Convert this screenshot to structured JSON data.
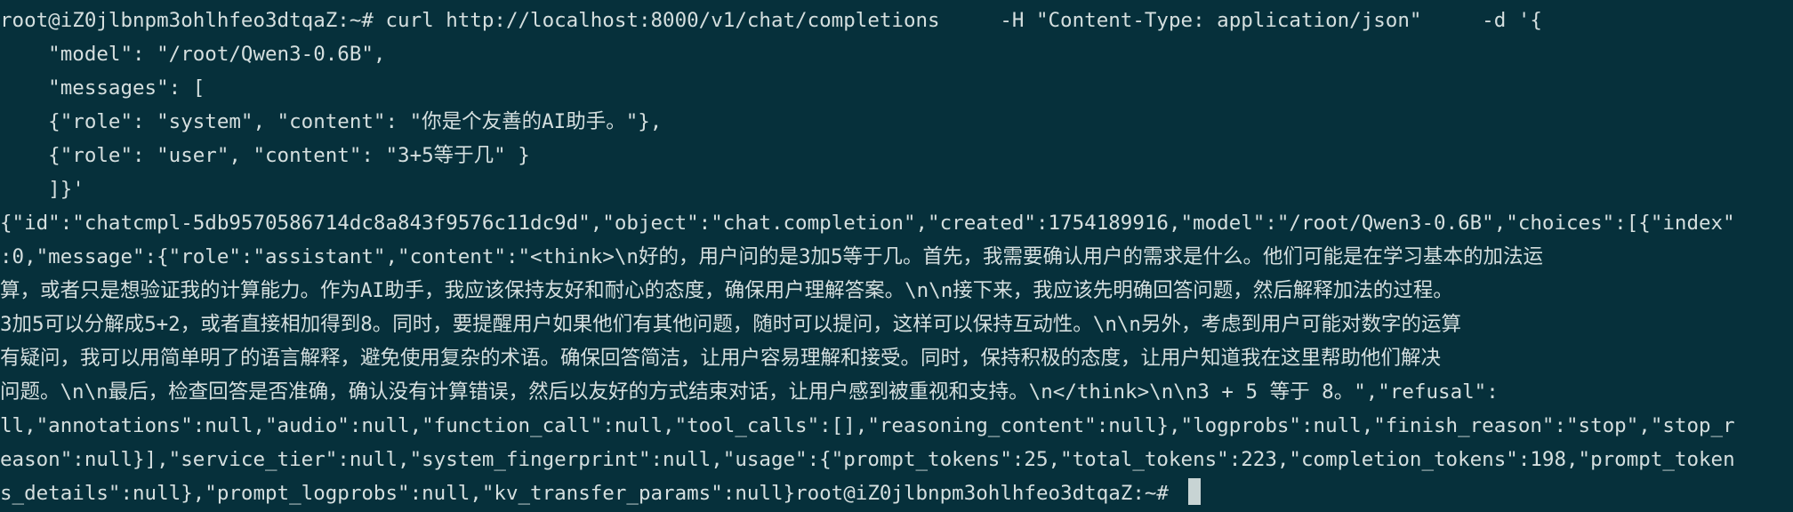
{
  "terminal": {
    "background": "#06303b",
    "foreground": "#d5dfdf",
    "lines": [
      "root@iZ0jlbnpm3ohlhfeo3dtqaZ:~# curl http://localhost:8000/v1/chat/completions     -H \"Content-Type: application/json\"     -d '{",
      "    \"model\": \"/root/Qwen3-0.6B\",",
      "    \"messages\": [",
      "    {\"role\": \"system\", \"content\": \"你是个友善的AI助手。\"},",
      "    {\"role\": \"user\", \"content\": \"3+5等于几\" }",
      "    ]}'",
      "{\"id\":\"chatcmpl-5db9570586714dc8a843f9576c11dc9d\",\"object\":\"chat.completion\",\"created\":1754189916,\"model\":\"/root/Qwen3-0.6B\",\"choices\":[{\"index\"",
      ":0,\"message\":{\"role\":\"assistant\",\"content\":\"<think>\\n好的，用户问的是3加5等于几。首先，我需要确认用户的需求是什么。他们可能是在学习基本的加法运",
      "算，或者只是想验证我的计算能力。作为AI助手，我应该保持友好和耐心的态度，确保用户理解答案。\\n\\n接下来，我应该先明确回答问题，然后解释加法的过程。",
      "3加5可以分解成5+2，或者直接相加得到8。同时，要提醒用户如果他们有其他问题，随时可以提问，这样可以保持互动性。\\n\\n另外，考虑到用户可能对数字的运算",
      "有疑问，我可以用简单明了的语言解释，避免使用复杂的术语。确保回答简洁，让用户容易理解和接受。同时，保持积极的态度，让用户知道我在这里帮助他们解决",
      "问题。\\n\\n最后，检查回答是否准确，确认没有计算错误，然后以友好的方式结束对话，让用户感到被重视和支持。\\n</think>\\n\\n3 + 5 等于 8。\",\"refusal\":",
      "ll,\"annotations\":null,\"audio\":null,\"function_call\":null,\"tool_calls\":[],\"reasoning_content\":null},\"logprobs\":null,\"finish_reason\":\"stop\",\"stop_r",
      "eason\":null}],\"service_tier\":null,\"system_fingerprint\":null,\"usage\":{\"prompt_tokens\":25,\"total_tokens\":223,\"completion_tokens\":198,\"prompt_token",
      "s_details\":null},\"prompt_logprobs\":null,\"kv_transfer_params\":null}root@iZ0jlbnpm3ohlhfeo3dtqaZ:~# "
    ]
  }
}
